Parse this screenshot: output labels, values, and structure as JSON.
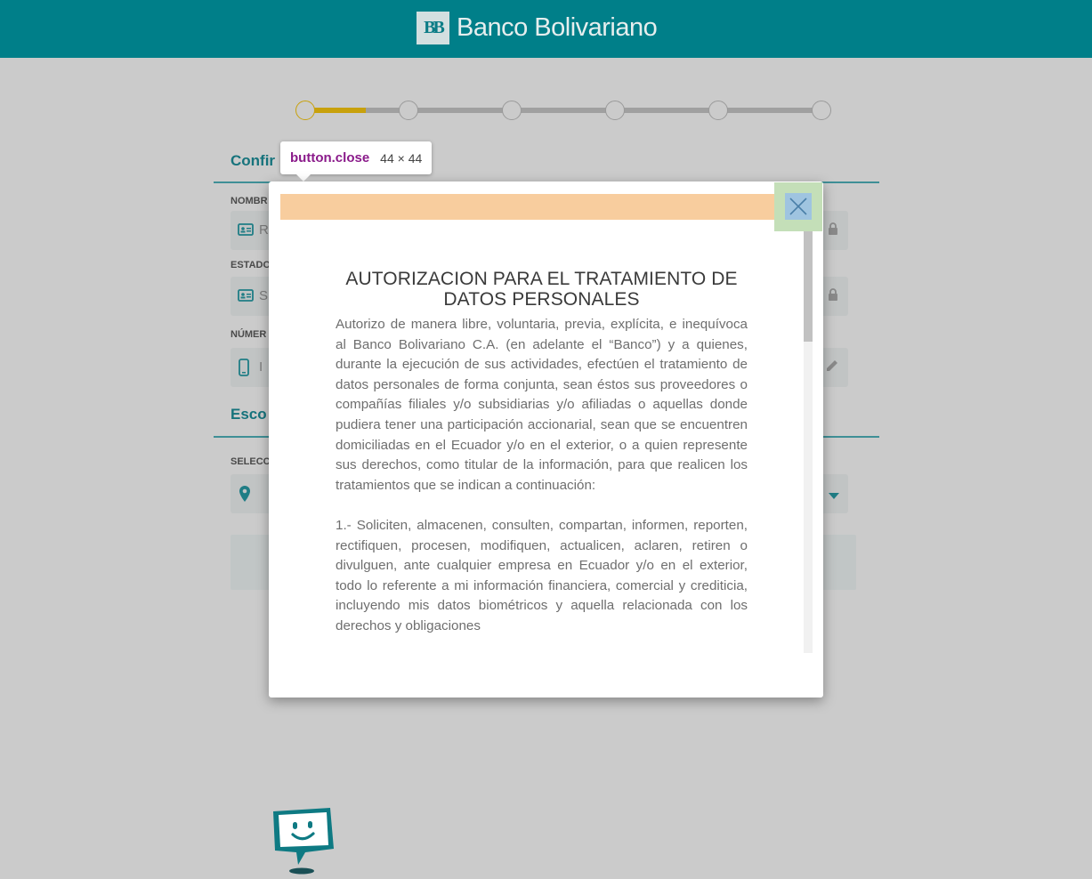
{
  "header": {
    "brand_mark": "BB",
    "brand_name": "Banco Bolivariano"
  },
  "stepper": {
    "total_steps": 6,
    "current_step": 1
  },
  "form": {
    "section1_title": "Confir",
    "label_name": "NOMBR",
    "value_name": "R",
    "label_status": "ESTADO",
    "value_status": "S",
    "label_number": "NÚMER",
    "value_number": "I",
    "section2_title": "Esco",
    "label_select": "SELECC"
  },
  "devtools_tooltip": {
    "selector": "button.close",
    "size": "44 × 44"
  },
  "modal": {
    "title": "AUTORIZACION PARA EL TRATAMIENTO DE DATOS PERSONALES",
    "paragraph1": "Autorizo de manera libre, voluntaria, previa, explícita, e inequívoca al Banco Bolivariano C.A. (en adelante el “Banco”) y a quienes, durante la ejecución de sus actividades, efectúen el tratamiento de datos personales de forma conjunta, sean éstos sus proveedores o compañías filiales y/o subsidiarias y/o afiliadas o aquellas donde pudiera tener una participación accionarial, sean que se encuentren domiciliadas en el Ecuador y/o en el exterior, o a quien represente sus derechos, como titular de la información, para que realicen los tratamientos que se indican a continuación:",
    "paragraph2": "1.- Soliciten, almacenen, consulten, compartan, informen, reporten, rectifiquen, procesen, modifiquen, actualicen, aclaren, retiren o divulguen, ante cualquier empresa en Ecuador y/o en el exterior, todo lo referente a mi información financiera, comercial y crediticia, incluyendo mis datos biométricos y aquella relacionada con los derechos y obligaciones"
  },
  "colors": {
    "header_bg": "#007f89",
    "accent_gold": "#c8a10c",
    "teal": "#16737c"
  }
}
